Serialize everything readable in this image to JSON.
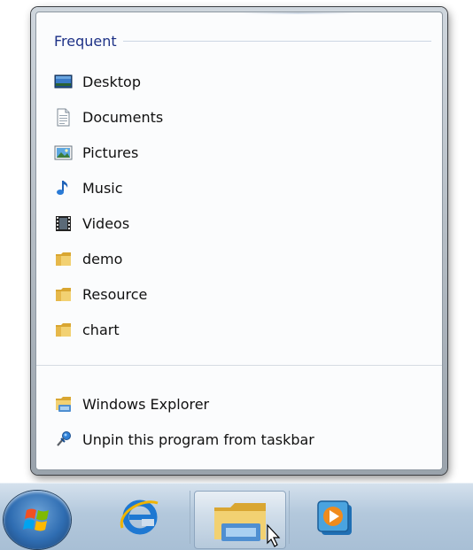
{
  "jumplist": {
    "frequent_title": "Frequent",
    "items": [
      {
        "label": "Desktop",
        "icon": "desktop-icon"
      },
      {
        "label": "Documents",
        "icon": "documents-icon"
      },
      {
        "label": "Pictures",
        "icon": "pictures-icon"
      },
      {
        "label": "Music",
        "icon": "music-icon"
      },
      {
        "label": "Videos",
        "icon": "videos-icon"
      },
      {
        "label": "demo",
        "icon": "folder-icon"
      },
      {
        "label": "Resource",
        "icon": "folder-icon"
      },
      {
        "label": "chart",
        "icon": "folder-icon"
      }
    ],
    "tasks": [
      {
        "label": "Windows Explorer",
        "icon": "windows-explorer-icon"
      },
      {
        "label": "Unpin this program from taskbar",
        "icon": "unpin-icon"
      }
    ]
  },
  "taskbar": {
    "buttons": [
      {
        "name": "start-button",
        "icon": "windows-logo-icon"
      },
      {
        "name": "internet-explorer",
        "icon": "ie-icon"
      },
      {
        "name": "windows-explorer",
        "icon": "folder-library-icon",
        "active": true
      },
      {
        "name": "windows-media-player",
        "icon": "media-player-icon"
      }
    ]
  },
  "colors": {
    "category_title": "#1e3287",
    "folder_yellow": "#e8c65a",
    "taskbar_top": "#d5e1ed",
    "taskbar_bottom": "#a8bfd5"
  }
}
